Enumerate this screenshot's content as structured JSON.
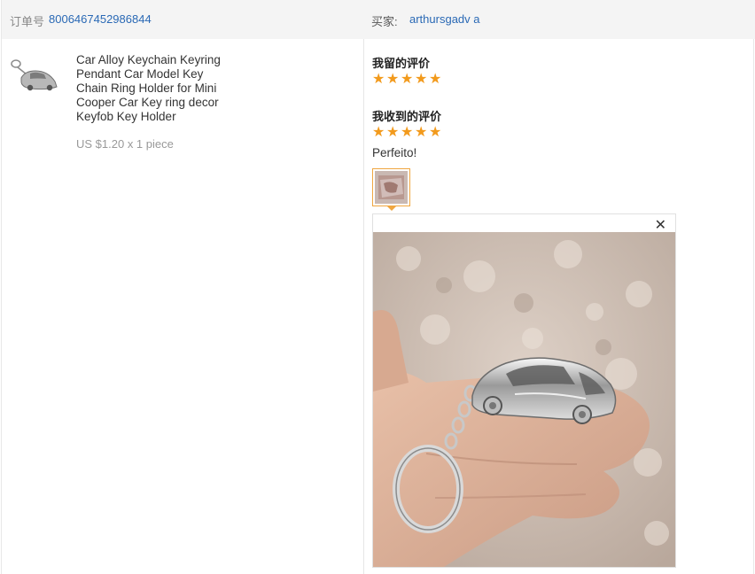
{
  "order": {
    "label": "订单号",
    "number": "8006467452986844"
  },
  "buyer": {
    "label": "买家:",
    "name": "arthursgadv a"
  },
  "product": {
    "title": "Car Alloy Keychain Keyring Pendant Car Model Key Chain Ring Holder for Mini Cooper Car Key ring decor Keyfob Key Holder",
    "price": "US $1.20 x 1 piece",
    "thumb_icon": "car-keychain-image"
  },
  "reviews": {
    "left_heading": "我留的评价",
    "left_stars": 5,
    "received_heading": "我收到的评价",
    "received_stars": 5,
    "received_text": "Perfeito!",
    "star_glyph": "★",
    "star_color": "#f29a1c",
    "close_glyph": "✕"
  },
  "colors": {
    "link": "#2a69b5",
    "header_bg": "#f4f4f4",
    "accent": "#f0a640"
  }
}
